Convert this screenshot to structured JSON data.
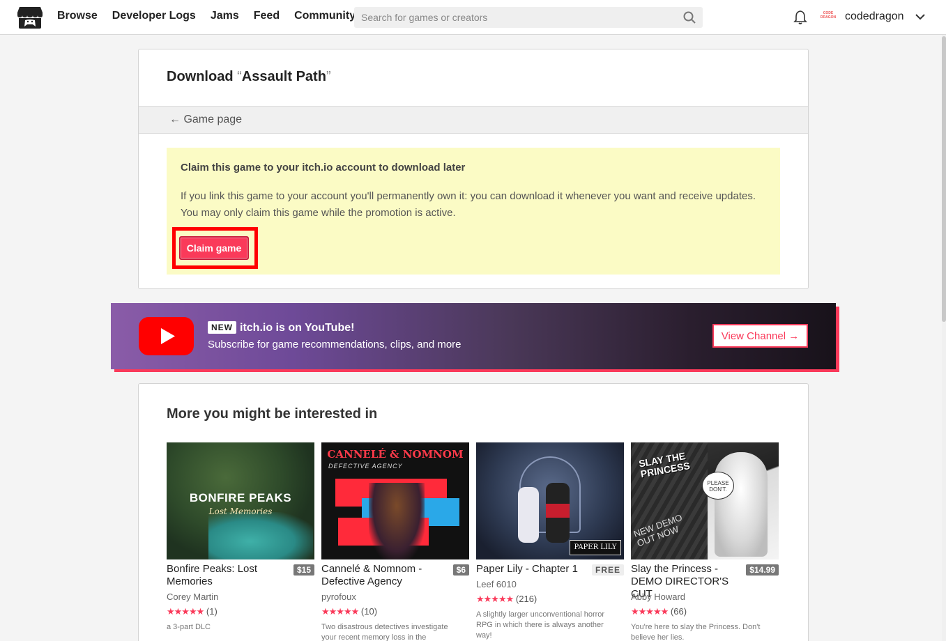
{
  "header": {
    "nav": [
      "Browse",
      "Developer Logs",
      "Jams",
      "Feed",
      "Community"
    ],
    "search_placeholder": "Search for games or creators",
    "avatar_text": "CODE DRAGON",
    "username": "codedragon"
  },
  "download": {
    "title_prefix": "Download ",
    "open_quote": "“",
    "game_name": "Assault Path",
    "close_quote": "”",
    "back_link": "← Game page",
    "notice_title": "Claim this game to your itch.io account to download later",
    "notice_body": "If you link this game to your account you'll permanently own it: you can download it whenever you want and receive updates. You may only claim this game while the promotion is active.",
    "claim_button": "Claim game"
  },
  "youtube_banner": {
    "badge": "NEW",
    "title": "itch.io is on YouTube!",
    "subtitle": "Subscribe for game recommendations, clips, and more",
    "button": "View Channel →"
  },
  "recommendations": {
    "heading": "More you might be interested in",
    "games": [
      {
        "title": "Bonfire Peaks: Lost Memories",
        "price": "$15",
        "author": "Corey Martin",
        "stars": "★★★★★",
        "count": "(1)",
        "desc": "a 3-part DLC",
        "thumb_text": "BONFIRE PEAKS",
        "thumb_sub": "Lost Memories"
      },
      {
        "title": "Cannelé & Nomnom - Defective Agency",
        "price": "$6",
        "author": "pyrofoux",
        "stars": "★★★★★",
        "count": "(10)",
        "desc": "Two disastrous detectives investigate your recent memory loss in the",
        "thumb_text": "CANNELÉ & NOMNOM",
        "thumb_sub": "DEFECTIVE AGENCY"
      },
      {
        "title": "Paper Lily - Chapter 1",
        "price": "FREE",
        "author": "Leef 6010",
        "stars": "★★★★★",
        "count": "(216)",
        "desc": "A slightly larger unconventional horror RPG in which there is always another way!",
        "thumb_text": "PAPER LILY"
      },
      {
        "title": "Slay the Princess - DEMO DIRECTOR'S CUT",
        "price": "$14.99",
        "author": "Abby Howard",
        "stars": "★★★★★",
        "count": "(66)",
        "desc": "You're here to slay the Princess. Don't believe her lies.",
        "thumb_text": "SLAY THE PRINCESS",
        "thumb_sub": "NEW DEMO OUT NOW",
        "thumb_note": "PLEASE DON'T."
      }
    ]
  },
  "colors": {
    "accent": "#fa3a5a",
    "notice_bg": "#fbfbc5",
    "highlight": "#ff0000"
  }
}
